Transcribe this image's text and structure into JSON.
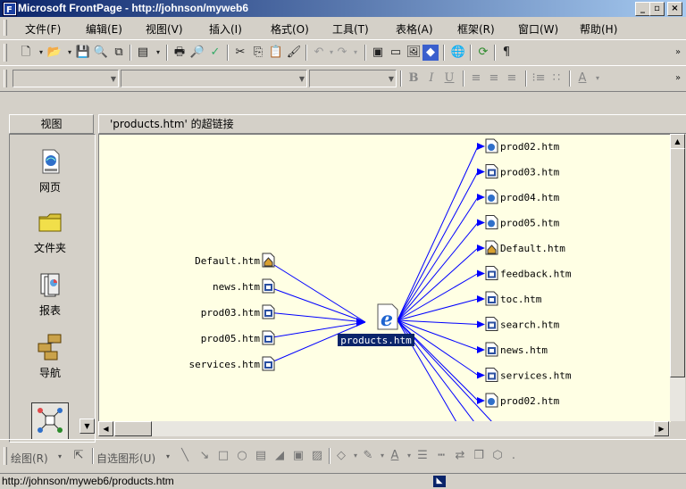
{
  "window": {
    "title": "Microsoft FrontPage - http://johnson/myweb6",
    "controls": [
      "minimize",
      "restore",
      "close"
    ]
  },
  "menu": {
    "items": [
      "文件(F)",
      "编辑(E)",
      "视图(V)",
      "插入(I)",
      "格式(O)",
      "工具(T)",
      "表格(A)",
      "框架(R)",
      "窗口(W)",
      "帮助(H)"
    ]
  },
  "format_toolbar": {
    "style_value": "",
    "font_value": "",
    "size_value": "",
    "bold": "B",
    "italic": "I",
    "underline": "U",
    "font_color": "A"
  },
  "views": {
    "header": "视图",
    "items": [
      {
        "label": "网页",
        "icon": "page-icon"
      },
      {
        "label": "文件夹",
        "icon": "folder-icon"
      },
      {
        "label": "报表",
        "icon": "reports-icon"
      },
      {
        "label": "导航",
        "icon": "navigation-icon"
      },
      {
        "label": "",
        "icon": "hyperlinks-icon"
      }
    ]
  },
  "hyperlinks_view": {
    "header": "'products.htm' 的超链接",
    "center": "products.htm",
    "incoming": [
      {
        "name": "Default.htm",
        "icon": "home-page-icon"
      },
      {
        "name": "news.htm",
        "icon": "page-icon"
      },
      {
        "name": "prod03.htm",
        "icon": "page-icon"
      },
      {
        "name": "prod05.htm",
        "icon": "page-icon"
      },
      {
        "name": "services.htm",
        "icon": "page-icon"
      }
    ],
    "outgoing": [
      {
        "name": "prod02.htm",
        "icon": "ie-page-icon"
      },
      {
        "name": "prod03.htm",
        "icon": "page-icon"
      },
      {
        "name": "prod04.htm",
        "icon": "ie-page-icon"
      },
      {
        "name": "prod05.htm",
        "icon": "ie-page-icon"
      },
      {
        "name": "Default.htm",
        "icon": "home-page-icon"
      },
      {
        "name": "feedback.htm",
        "icon": "page-icon"
      },
      {
        "name": "toc.htm",
        "icon": "page-icon"
      },
      {
        "name": "search.htm",
        "icon": "page-icon"
      },
      {
        "name": "news.htm",
        "icon": "page-icon"
      },
      {
        "name": "services.htm",
        "icon": "page-icon"
      },
      {
        "name": "prod02.htm",
        "icon": "ie-page-icon"
      }
    ]
  },
  "drawing_toolbar": {
    "draw_label": "绘图(R)",
    "autoshapes_label": "自选图形(U)"
  },
  "status": {
    "text": "http://johnson/myweb6/products.htm"
  },
  "colors": {
    "link_line": "#0000ff",
    "canvas_bg": "#ffffe4",
    "title_start": "#0a246a",
    "title_end": "#a6caf0",
    "selected_bg": "#0a246a"
  }
}
